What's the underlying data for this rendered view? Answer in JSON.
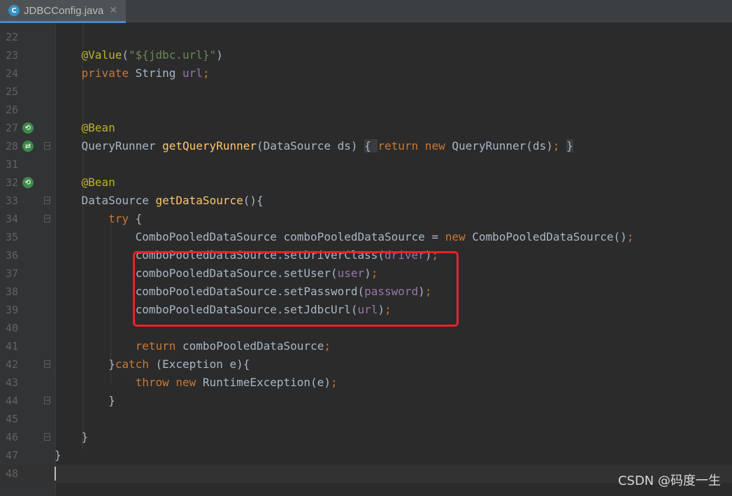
{
  "tab": {
    "icon_letter": "C",
    "file_name": "JDBCConfig.java",
    "close_glyph": "✕"
  },
  "watermark": "CSDN @码度一生",
  "highlight_color": "#e8222a",
  "lines": [
    {
      "no": "22",
      "tokens": []
    },
    {
      "no": "23",
      "tokens": [
        {
          "t": "    @Value",
          "c": "ann"
        },
        {
          "t": "(",
          "c": "plain"
        },
        {
          "t": "\"${jdbc.url}\"",
          "c": "str"
        },
        {
          "t": ")",
          "c": "plain"
        }
      ]
    },
    {
      "no": "24",
      "tokens": [
        {
          "t": "    private ",
          "c": "kw"
        },
        {
          "t": "String ",
          "c": "plain"
        },
        {
          "t": "url",
          "c": "field"
        },
        {
          "t": ";",
          "c": "kw"
        }
      ]
    },
    {
      "no": "25",
      "tokens": []
    },
    {
      "no": "26",
      "tokens": []
    },
    {
      "no": "27",
      "icon": "bean",
      "tokens": [
        {
          "t": "    @Bean",
          "c": "ann"
        }
      ]
    },
    {
      "no": "28",
      "icon": "bean-arrow",
      "fold": true,
      "tokens": [
        {
          "t": "    QueryRunner ",
          "c": "plain"
        },
        {
          "t": "getQueryRunner",
          "c": "method"
        },
        {
          "t": "(DataSource ds) ",
          "c": "plain"
        },
        {
          "t": "{ ",
          "c": "fold"
        },
        {
          "t": "return new ",
          "c": "kw"
        },
        {
          "t": "QueryRunner(ds)",
          "c": "plain"
        },
        {
          "t": "; ",
          "c": "kw"
        },
        {
          "t": "}",
          "c": "fold"
        }
      ]
    },
    {
      "no": "31",
      "tokens": []
    },
    {
      "no": "32",
      "icon": "bean",
      "tokens": [
        {
          "t": "    @Bean",
          "c": "ann"
        }
      ]
    },
    {
      "no": "33",
      "fold": true,
      "tokens": [
        {
          "t": "    DataSource ",
          "c": "plain"
        },
        {
          "t": "getDataSource",
          "c": "method"
        },
        {
          "t": "(){",
          "c": "plain"
        }
      ]
    },
    {
      "no": "34",
      "fold": true,
      "tokens": [
        {
          "t": "        try ",
          "c": "kw"
        },
        {
          "t": "{",
          "c": "plain"
        }
      ]
    },
    {
      "no": "35",
      "tokens": [
        {
          "t": "            ComboPooledDataSource comboPooledDataSource = ",
          "c": "plain"
        },
        {
          "t": "new ",
          "c": "kw"
        },
        {
          "t": "ComboPooledDataSource()",
          "c": "plain"
        },
        {
          "t": ";",
          "c": "kw"
        }
      ]
    },
    {
      "no": "36",
      "tokens": [
        {
          "t": "            comboPooledDataSource.setDriverClass(",
          "c": "plain"
        },
        {
          "t": "driver",
          "c": "field"
        },
        {
          "t": ")",
          "c": "plain"
        },
        {
          "t": ";",
          "c": "kw"
        }
      ]
    },
    {
      "no": "37",
      "tokens": [
        {
          "t": "            comboPooledDataSource.setUser(",
          "c": "plain"
        },
        {
          "t": "user",
          "c": "field"
        },
        {
          "t": ")",
          "c": "plain"
        },
        {
          "t": ";",
          "c": "kw"
        }
      ]
    },
    {
      "no": "38",
      "tokens": [
        {
          "t": "            comboPooledDataSource.setPassword(",
          "c": "plain"
        },
        {
          "t": "password",
          "c": "field"
        },
        {
          "t": ")",
          "c": "plain"
        },
        {
          "t": ";",
          "c": "kw"
        }
      ]
    },
    {
      "no": "39",
      "tokens": [
        {
          "t": "            comboPooledDataSource.setJdbcUrl(",
          "c": "plain"
        },
        {
          "t": "url",
          "c": "field"
        },
        {
          "t": ")",
          "c": "plain"
        },
        {
          "t": ";",
          "c": "kw"
        }
      ]
    },
    {
      "no": "40",
      "tokens": []
    },
    {
      "no": "41",
      "tokens": [
        {
          "t": "            return ",
          "c": "kw"
        },
        {
          "t": "comboPooledDataSource",
          "c": "plain"
        },
        {
          "t": ";",
          "c": "kw"
        }
      ]
    },
    {
      "no": "42",
      "fold": true,
      "tokens": [
        {
          "t": "        }",
          "c": "plain"
        },
        {
          "t": "catch ",
          "c": "kw"
        },
        {
          "t": "(Exception e){",
          "c": "plain"
        }
      ]
    },
    {
      "no": "43",
      "tokens": [
        {
          "t": "            throw new ",
          "c": "kw"
        },
        {
          "t": "RuntimeException(e)",
          "c": "plain"
        },
        {
          "t": ";",
          "c": "kw"
        }
      ]
    },
    {
      "no": "44",
      "fold": true,
      "tokens": [
        {
          "t": "        }",
          "c": "plain"
        }
      ]
    },
    {
      "no": "45",
      "tokens": []
    },
    {
      "no": "46",
      "fold": true,
      "tokens": [
        {
          "t": "    }",
          "c": "plain"
        }
      ]
    },
    {
      "no": "47",
      "tokens": [
        {
          "t": "}",
          "c": "plain"
        }
      ]
    },
    {
      "no": "48",
      "current": true,
      "caret": true,
      "tokens": []
    }
  ]
}
